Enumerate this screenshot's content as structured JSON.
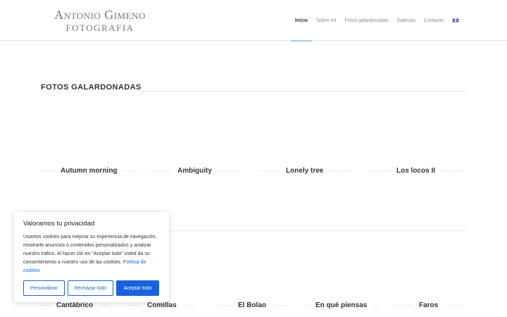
{
  "header": {
    "logo_line1": "Antonio Gimeno",
    "logo_line2": "FOTOGRAFIA",
    "nav": [
      {
        "label": "Inicio",
        "active": true
      },
      {
        "label": "Sobre mí"
      },
      {
        "label": "Fotos galardonadas"
      },
      {
        "label": "Galerías"
      },
      {
        "label": "Contacto"
      }
    ],
    "language_icon": "uk-flag-icon"
  },
  "main": {
    "section_title": "FOTOS GALARDONADAS",
    "awarded": [
      "Autumn morning",
      "Ambiguity",
      "Lonely tree",
      "Los locos II"
    ],
    "galleries": [
      "Cantábrico",
      "Comillas",
      "El Bolao",
      "En qué piensas",
      "Faros"
    ]
  },
  "cookie": {
    "title": "Valoramos tu privacidad",
    "text": "Usamos cookies para mejorar su experiencia de navegación, mostrarle anuncios o contenidos personalizados y analizar nuestro tráfico. Al hacer clic en “Aceptar todo” usted da su consentimiento a nuestro uso de las cookies.",
    "policy_link": "Política de cookies",
    "buttons": {
      "customize": "Personalizar",
      "reject": "Rechazar todo",
      "accept": "Aceptar todo"
    },
    "accent_color": "#1863dc"
  }
}
